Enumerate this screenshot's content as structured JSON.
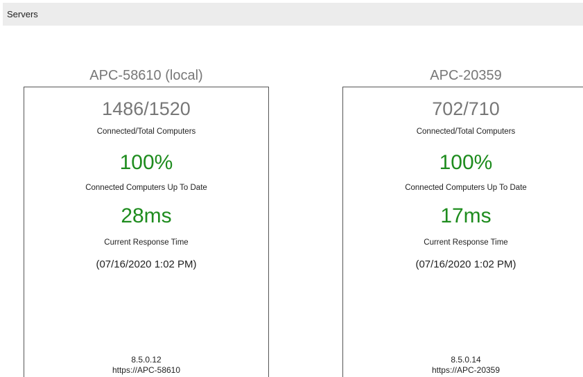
{
  "header": {
    "title": "Servers"
  },
  "servers": [
    {
      "name": "APC-58610 (local)",
      "connected_total": "1486/1520",
      "connected_total_label": "Connected/Total Computers",
      "up_to_date": "100%",
      "up_to_date_label": "Connected Computers Up To Date",
      "response_time": "28ms",
      "response_time_label": "Current Response Time",
      "timestamp": "(07/16/2020 1:02 PM)",
      "version": "8.5.0.12",
      "url": "https://APC-58610"
    },
    {
      "name": "APC-20359",
      "connected_total": "702/710",
      "connected_total_label": "Connected/Total Computers",
      "up_to_date": "100%",
      "up_to_date_label": "Connected Computers Up To Date",
      "response_time": "17ms",
      "response_time_label": "Current Response Time",
      "timestamp": "(07/16/2020 1:02 PM)",
      "version": "8.5.0.14",
      "url": "https://APC-20359"
    }
  ],
  "colors": {
    "header_background": "#ececec",
    "status_green": "#1e8c1e",
    "muted_gray": "#777777",
    "card_border": "#555555"
  }
}
